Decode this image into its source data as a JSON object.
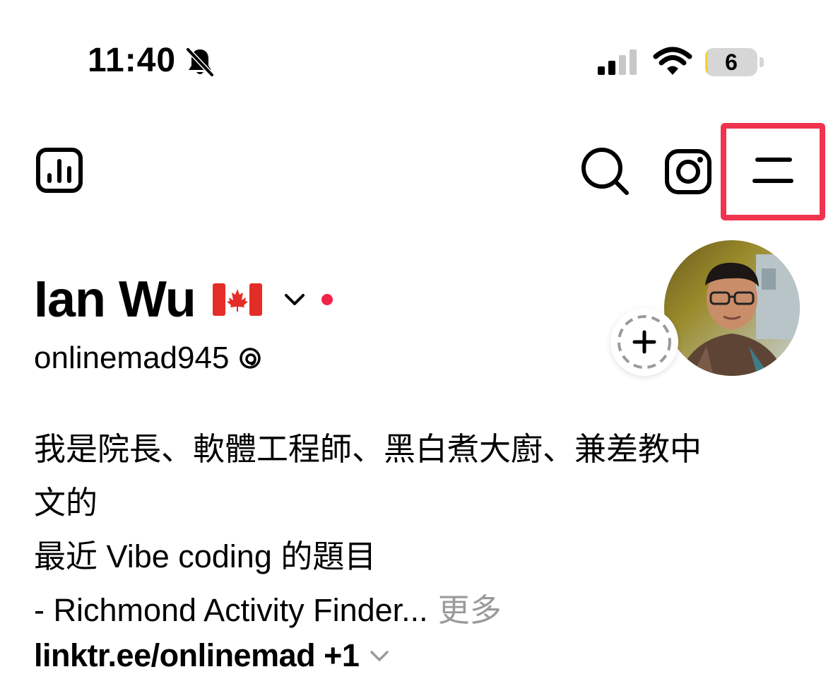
{
  "status_bar": {
    "time": "11:40",
    "battery_level": "6",
    "battery_fill_percent": 6,
    "icons": [
      "bell-slash-icon",
      "cellular-signal-icon",
      "wifi-icon",
      "battery-icon"
    ]
  },
  "toolbar": {
    "icons": [
      "insights-icon",
      "search-icon",
      "instagram-icon",
      "menu-icon"
    ],
    "highlight_color": "#f0334f"
  },
  "profile": {
    "name": "Ian Wu",
    "flag": "canada-flag-icon",
    "notification_dot_color": "#f0234a",
    "username": "onlinemad945",
    "username_icon": "threads-icon"
  },
  "bio": {
    "lines": [
      "我是院長、軟體工程師、黑白煮大廚、兼差教中",
      "文的",
      "最近 Vibe coding 的題目",
      "- Richmond Activity Finder..."
    ],
    "more_label": "更多",
    "links_label": "linktr.ee/onlinemad +1"
  }
}
